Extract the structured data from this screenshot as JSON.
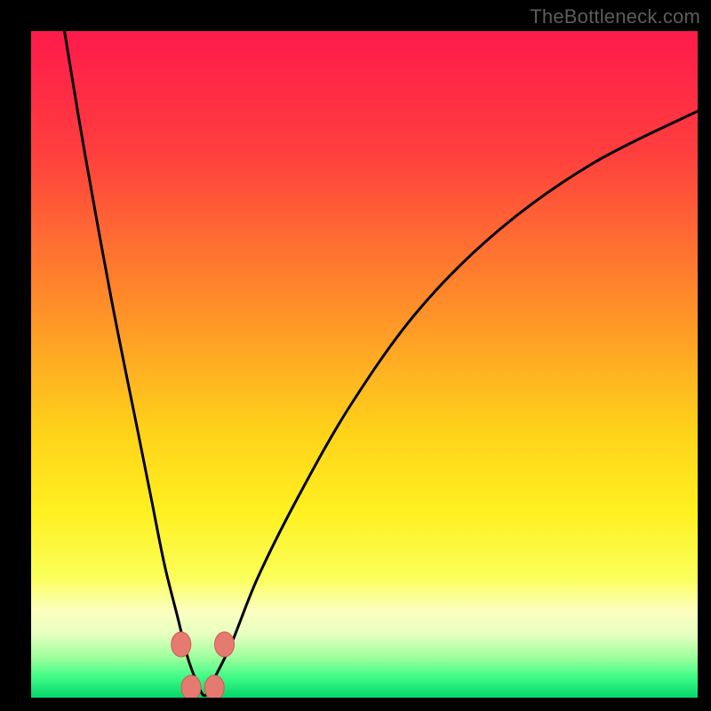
{
  "watermark": "TheBottleneck.com",
  "colors": {
    "frame": "#000000",
    "watermark": "#5c5c5c",
    "gradient_stops": [
      {
        "offset": 0.0,
        "color": "#ff1a4b"
      },
      {
        "offset": 0.18,
        "color": "#ff3e3e"
      },
      {
        "offset": 0.4,
        "color": "#ff8a2a"
      },
      {
        "offset": 0.6,
        "color": "#ffd21a"
      },
      {
        "offset": 0.72,
        "color": "#fff020"
      },
      {
        "offset": 0.82,
        "color": "#fbff5a"
      },
      {
        "offset": 0.87,
        "color": "#fdffc0"
      },
      {
        "offset": 0.905,
        "color": "#e6ffc0"
      },
      {
        "offset": 0.94,
        "color": "#9cff9c"
      },
      {
        "offset": 0.97,
        "color": "#3dfb86"
      },
      {
        "offset": 1.0,
        "color": "#05d66a"
      }
    ],
    "curve_stroke": "#000000",
    "marker_fill": "#e57a71",
    "marker_stroke": "#cf5a51"
  },
  "chart_data": {
    "type": "line",
    "title": "",
    "xlabel": "",
    "ylabel": "",
    "xlim": [
      0,
      100
    ],
    "ylim": [
      0,
      100
    ],
    "series": [
      {
        "name": "bottleneck-curve",
        "x": [
          5,
          8,
          12,
          16,
          18,
          20,
          22,
          23.5,
          25,
          26,
          27,
          30,
          34,
          40,
          48,
          58,
          70,
          84,
          100
        ],
        "y": [
          100,
          82,
          60,
          40,
          30,
          20,
          12,
          6,
          2,
          0.3,
          2,
          8,
          18,
          30,
          44,
          58,
          70,
          80,
          88
        ]
      }
    ],
    "markers": [
      {
        "x": 22.5,
        "y": 8.0
      },
      {
        "x": 29.0,
        "y": 8.0
      },
      {
        "x": 24.0,
        "y": 1.5
      },
      {
        "x": 27.5,
        "y": 1.5
      }
    ],
    "minimum_x": 25.5
  }
}
